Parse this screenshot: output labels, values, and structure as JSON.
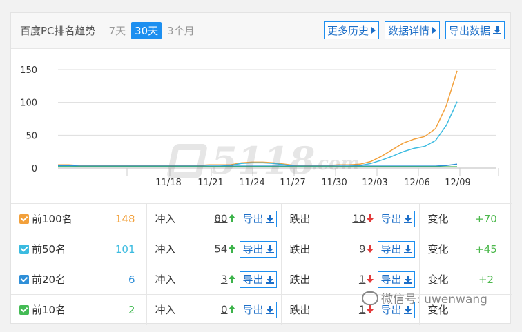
{
  "header": {
    "title": "百度PC排名趋势",
    "tabs": [
      {
        "label": "7天",
        "active": false
      },
      {
        "label": "30天",
        "active": true
      },
      {
        "label": "3个月",
        "active": false
      }
    ],
    "buttons": [
      "更多历史",
      "数据详情",
      "导出数据"
    ]
  },
  "watermark": {
    "brand": "5118",
    "suffix": ".com"
  },
  "chart_data": {
    "type": "line",
    "ylim": [
      0,
      150
    ],
    "yticks": [
      "0",
      "50",
      "100",
      "150"
    ],
    "xtick_labels": [
      "11/18",
      "11/21",
      "11/24",
      "11/27",
      "11/30",
      "12/03",
      "12/06",
      "12/09"
    ],
    "grid": true,
    "series": [
      {
        "color": "#f2a03b",
        "values": [
          5,
          5,
          4,
          4,
          4,
          4,
          4,
          4,
          4,
          4,
          4,
          4,
          4,
          4,
          5,
          5,
          5,
          8,
          9,
          9,
          8,
          6,
          4,
          4,
          4,
          4,
          5,
          5,
          6,
          10,
          18,
          28,
          38,
          44,
          48,
          60,
          95,
          148
        ]
      },
      {
        "color": "#3bbbe0",
        "values": [
          3,
          3,
          3,
          3,
          3,
          3,
          3,
          3,
          3,
          3,
          3,
          3,
          3,
          3,
          3,
          3,
          4,
          7,
          8,
          8,
          7,
          5,
          3,
          3,
          3,
          3,
          3,
          3,
          4,
          7,
          12,
          18,
          25,
          30,
          33,
          42,
          65,
          101
        ]
      },
      {
        "color": "#2f8fd8",
        "values": [
          4,
          4,
          3,
          3,
          3,
          3,
          3,
          3,
          3,
          3,
          3,
          3,
          3,
          3,
          3,
          3,
          3,
          3,
          3,
          3,
          3,
          3,
          3,
          3,
          3,
          3,
          3,
          3,
          3,
          3,
          3,
          3,
          3,
          3,
          3,
          3,
          4,
          6
        ]
      },
      {
        "color": "#44bb55",
        "values": [
          2,
          2,
          2,
          2,
          2,
          2,
          2,
          2,
          2,
          2,
          2,
          2,
          2,
          2,
          2,
          2,
          2,
          2,
          2,
          2,
          2,
          2,
          2,
          2,
          2,
          2,
          2,
          2,
          2,
          2,
          2,
          2,
          2,
          2,
          2,
          2,
          2,
          2
        ]
      }
    ]
  },
  "rows": [
    {
      "name": "前100名",
      "color": "#f2a03b",
      "total": "148",
      "in_label": "冲入",
      "in_val": "80",
      "out_label": "跌出",
      "out_val": "10",
      "chg_label": "变化",
      "chg_val": "+70",
      "export": "导出"
    },
    {
      "name": "前50名",
      "color": "#3bbbe0",
      "total": "101",
      "in_label": "冲入",
      "in_val": "54",
      "out_label": "跌出",
      "out_val": "9",
      "chg_label": "变化",
      "chg_val": "+45",
      "export": "导出"
    },
    {
      "name": "前20名",
      "color": "#2f8fd8",
      "total": "6",
      "in_label": "冲入",
      "in_val": "3",
      "out_label": "跌出",
      "out_val": "1",
      "chg_label": "变化",
      "chg_val": "+2",
      "export": "导出"
    },
    {
      "name": "前10名",
      "color": "#44bb55",
      "total": "2",
      "in_label": "冲入",
      "in_val": "0",
      "out_label": "跌出",
      "out_val": "1",
      "chg_label": "变化",
      "chg_val": "",
      "export": "导出"
    }
  ],
  "overlay": {
    "text": "微信号: uwenwang"
  }
}
